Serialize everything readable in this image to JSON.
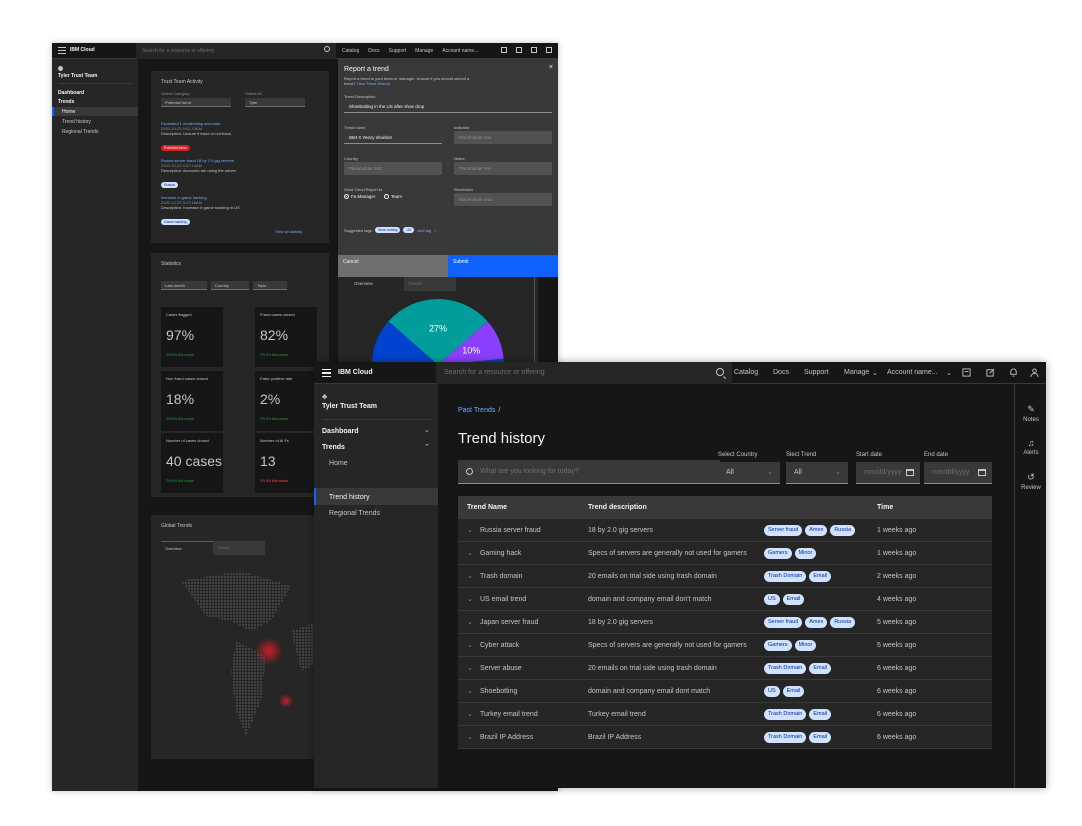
{
  "colors": {
    "brand_blue": "#0f62fe",
    "link_blue": "#78a9ff",
    "tag_bg": "#d0e2ff",
    "tag_fg": "#002d9c",
    "alert_red": "#da1e28",
    "pie_teal": "#009d9a",
    "pie_purple": "#8a3ffc",
    "pie_blue": "#0043ce"
  },
  "back": {
    "header": {
      "brand": "IBM Cloud",
      "search_placeholder": "Search for a resource or offering",
      "links": [
        "Catalog",
        "Docs",
        "Support",
        "Manage",
        "Account name..."
      ]
    },
    "sidebar": {
      "team": "Tyler Trust Team",
      "dashboard": "Dashboard",
      "trends": "Trends",
      "home": "Home",
      "trend_history": "Trend history",
      "regional": "Regional Trends"
    },
    "activity": {
      "title": "Trust Team Activity",
      "category_label": "Select Category",
      "category_value": "Potential trend",
      "user_label": "Select All",
      "user_value": "Tyler",
      "items": [
        {
          "head": "Escalated 1 moderating accounts",
          "by": "by Tyler",
          "time": "2020-10-23 9:01:13AM",
          "desc": "Description: Unsure if fraud or not fraud",
          "tag": "Potential trend"
        },
        {
          "head": "Russia server fraud 18 by 2.0 gig servers",
          "by": "by Fred",
          "time": "2020-10-22 8:07:14AM",
          "desc": "Description: Accounts are using the server",
          "tag": "Russia"
        },
        {
          "head": "Increase in game hacking",
          "by": "by Emily",
          "time": "2020-10-21 3:17:18AM",
          "desc": "Description: Increase in game hacking in US",
          "tag": "Game hacking"
        }
      ],
      "view_all": "View all activity"
    },
    "stats": {
      "title": "Statistics",
      "filters": [
        "Last month",
        "Country",
        "Topic"
      ],
      "cards": [
        {
          "label": "Cases flagged",
          "value": "97%",
          "foot": "2% 6% this month"
        },
        {
          "label": "Fraud cases closed",
          "value": "82%",
          "foot": "2% 6% this month"
        },
        {
          "label": "Non fraud cases closed",
          "value": "18%",
          "foot": "2% 6% this month"
        },
        {
          "label": "False positive rate",
          "value": "2%",
          "foot": "2% 6% this month"
        },
        {
          "label": "Number of cases closed",
          "value": "40 cases",
          "foot": "2% 6% this month"
        },
        {
          "label": "Number of AI Fs",
          "value": "13",
          "foot": "2% 6% this month"
        }
      ]
    },
    "global": {
      "title": "Global Trends",
      "tabs": [
        "Overview",
        "Trends"
      ]
    },
    "pie": {
      "tabs": [
        "Overview",
        "Trends"
      ],
      "slices": [
        {
          "label": "27%",
          "value": 27
        },
        {
          "label": "10%",
          "value": 10
        },
        {
          "label": "",
          "value": 63
        }
      ]
    },
    "modal": {
      "title": "Report a trend",
      "desc": "Report a trend to your team or manager. Unsure if you should submit a trend?",
      "desc_link": "View Trend History",
      "trend_desc_label": "Trend Description",
      "trend_desc_value": "Shoebotting in the US after shoe drop",
      "trend_name_label": "Trend name",
      "trend_name_value": "IBM X Yeezy shoebot",
      "indicator_label": "Indicator",
      "indicator_placeholder": "Placeholder text",
      "country_label": "Country",
      "country_placeholder": "Placeholder text",
      "notes_label": "Notes",
      "notes_placeholder": "Placeholder text",
      "send_label": "Send Trend Report to",
      "radio_manager": "Fa Manager",
      "radio_team": "Team",
      "resolution_label": "Resolution",
      "resolution_placeholder": "Placeholder text",
      "suggested_label": "Suggested tags",
      "suggested_tags": [
        "Shoe botting",
        "US"
      ],
      "add_tag": "Add tag",
      "cancel": "Cancel",
      "submit": "Submit"
    }
  },
  "front": {
    "header": {
      "brand": "IBM Cloud",
      "search_placeholder": "Search for a resource or offering",
      "links": [
        "Catalog",
        "Docs",
        "Support",
        "Manage"
      ],
      "account": "Account name..."
    },
    "sidebar": {
      "team": "Tyler Trust Team",
      "dashboard": "Dashboard",
      "trends": "Trends",
      "home": "Home",
      "trend_history": "Trend history",
      "regional": "Regional Trends"
    },
    "breadcrumb": {
      "link": "Past Trends",
      "sep": "/"
    },
    "title": "Trend history",
    "search_placeholder": "What are you looking for today?",
    "filters": {
      "country_label": "Select Country",
      "country_value": "All",
      "trend_label": "Slect Trend",
      "trend_value": "All",
      "start_label": "Start date",
      "start_placeholder": "mm/dd/yyyy",
      "end_label": "End date",
      "end_placeholder": "mm/dd/yyyy"
    },
    "table": {
      "headers": {
        "name": "Trend Name",
        "desc": "Trend description",
        "time": "Time"
      },
      "rows": [
        {
          "name": "Russia server fraud",
          "desc": "18 by 2.0 gig servers",
          "tags": [
            "Server fraud",
            "Amex",
            "Russia"
          ],
          "time": "1 weeks ago"
        },
        {
          "name": "Gaming hack",
          "desc": "Specs of servers are generally not used for gamers",
          "tags": [
            "Gamers",
            "Minor"
          ],
          "time": "1 weeks ago"
        },
        {
          "name": "Trash domain",
          "desc": "20 emails on trial side using trash domain",
          "tags": [
            "Trash Domain",
            "Email"
          ],
          "time": "2 weeks ago"
        },
        {
          "name": "US email trend",
          "desc": "domain and company email don't match",
          "tags": [
            "US",
            "Email"
          ],
          "time": "4 weeks ago"
        },
        {
          "name": "Japan server fraud",
          "desc": "18 by 2.0 gig servers",
          "tags": [
            "Server fraud",
            "Amex",
            "Russia"
          ],
          "time": "5 weeks ago"
        },
        {
          "name": "Cyber attack",
          "desc": "Specs of servers are generally not used for gamers",
          "tags": [
            "Gamers",
            "Minor"
          ],
          "time": "5 weeks ago"
        },
        {
          "name": "Server abuse",
          "desc": "20 emails on trial side using trash domain",
          "tags": [
            "Trash Domain",
            "Email"
          ],
          "time": "6 weeks ago"
        },
        {
          "name": "Shoebotting",
          "desc": "domain and company email dont match",
          "tags": [
            "US",
            "Email"
          ],
          "time": "6 weeks ago"
        },
        {
          "name": "Turkey email trend",
          "desc": "Turkey email trend",
          "tags": [
            "Trash Domain",
            "Email"
          ],
          "time": "6 weeks ago"
        },
        {
          "name": "Brazil IP Address",
          "desc": "Brazil IP Address",
          "tags": [
            "Trash Domain",
            "Email"
          ],
          "time": "6 weeks ago"
        }
      ]
    },
    "rail": {
      "notes": "Notes",
      "alerts": "Alerts",
      "review": "Review"
    }
  }
}
